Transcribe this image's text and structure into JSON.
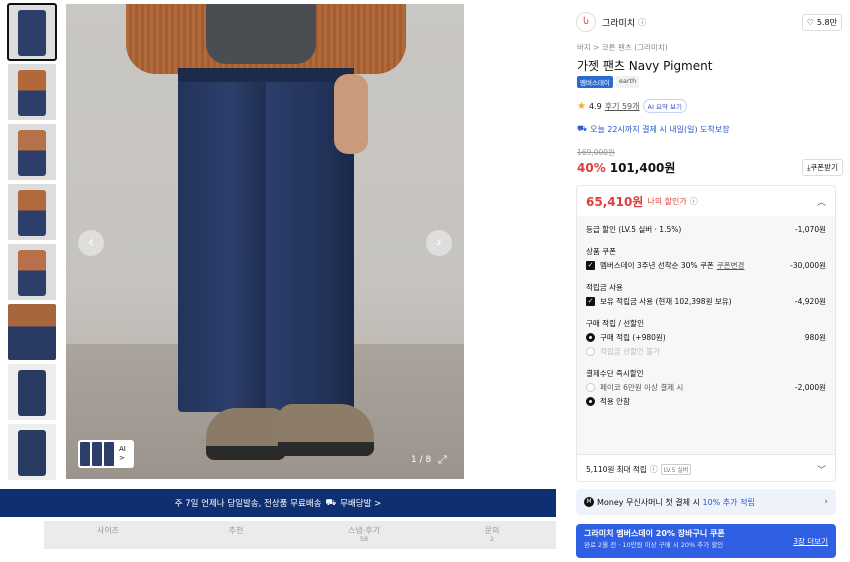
{
  "gallery": {
    "thumbnails": [
      {
        "bg": "#2c3f6b"
      },
      {
        "bg": "#b2693a"
      },
      {
        "bg": "#b5714a"
      },
      {
        "bg": "#b06a3b"
      },
      {
        "bg": "#b8704a"
      },
      {
        "bg": "#a8663c"
      },
      {
        "bg": "#2a3b63"
      },
      {
        "bg": "#2a3b63"
      }
    ],
    "ai_label": "AI",
    "ai_arrow": ">",
    "counter": "1 / 8"
  },
  "banner": {
    "text": "주 7일 언제나 당일발송, 전상품 무료배송",
    "link": "무배당발 >"
  },
  "tabs": [
    {
      "label": "사이즈",
      "sub": ""
    },
    {
      "label": "추천",
      "sub": ""
    },
    {
      "label": "스냅·후기",
      "sub": "58"
    },
    {
      "label": "문의",
      "sub": "2"
    }
  ],
  "product": {
    "brand": "그라미치",
    "likes": "5.8만",
    "breadcrumb": "바지 > 코튼 팬츠 (그라미치)",
    "title": "가젯 팬츠 Navy Pigment",
    "badge_member": "멤버스데이",
    "badge_earth": "earth",
    "rating": "4.9",
    "reviews": "후기 59개",
    "ai_summary": "AI 요약 보기",
    "delivery": "오늘 22시까지 결제 시 내일(일) 도착보장",
    "original_price": "169,000원",
    "discount": "40%",
    "price": "101,400원",
    "coupon_button": "쿠폰받기"
  },
  "my_price": {
    "price": "65,410원",
    "label": "나의 할인가",
    "grade_label": "등급 할인 (LV.5 실버 · 1.5%)",
    "grade_amount": "-1,070원",
    "coupon_section": "상품 쿠폰",
    "coupon_label": "멤버스데이 3주년 선착순 30% 쿠폰",
    "coupon_change": "쿠폰변경",
    "coupon_amount": "-30,000원",
    "points_section": "적립금 사용",
    "points_label": "보유 적립금 사용 (현재 102,398원 보유)",
    "points_amount": "-4,920원",
    "purchase_section": "구매 적립 / 선할인",
    "purchase_label": "구매 적립 (+980원)",
    "purchase_amount": "980원",
    "prediscount_label": "적립금 선할인 불가",
    "payment_section": "결제수단 즉시할인",
    "payco_label": "페이코 6만원 이상 결제 시",
    "payco_amount": "-2,000원",
    "none_label": "적용 안함",
    "footer_label": "5,110원 최대 적립",
    "footer_badge": "LV.5 실버"
  },
  "money": {
    "prefix": "Money 무신사머니 첫 결제 시",
    "highlight": "10% 추가 적립"
  },
  "promo": {
    "title": "그라미치 멤버스데이 20% 장바구니 쿠폰",
    "sub": "완료 2월 전 · 10만원 이상 구매 시 20% 추가 할인",
    "link": "3장 더보기"
  }
}
